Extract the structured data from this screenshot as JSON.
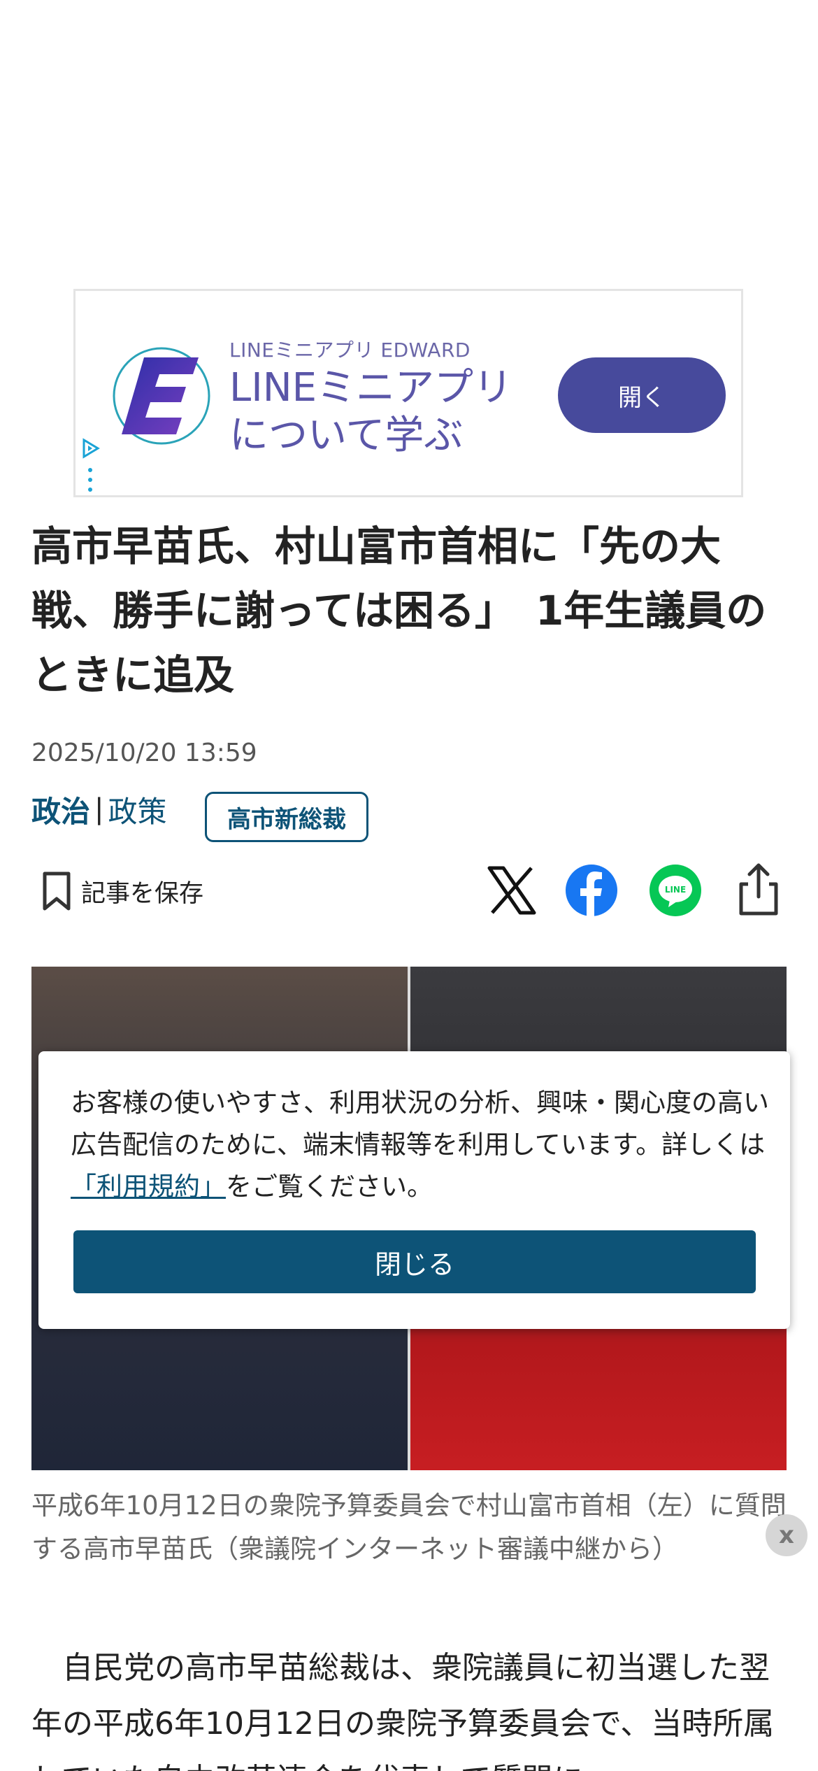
{
  "ad": {
    "eyebrow": "LINEミニアプリ EDWARD",
    "headline": "LINEミニアプリについて学ぶ",
    "open_button": "開く",
    "logo_letter": "E",
    "colors": {
      "button": "#474a9c",
      "headline": "#5a56a8"
    }
  },
  "article": {
    "title": "高市早苗氏、村山富市首相に「先の大戦、勝手に謝っては困る」　1年生議員のときに追及",
    "date": "2025/10/20 13:59",
    "category_main": "政治",
    "category_separator": "|",
    "category_sub": "政策",
    "tag": "高市新総裁",
    "save_label": "記事を保存",
    "caption": "平成6年10月12日の衆院予算委員会で村山富市首相（左）に質問する高市早苗氏（衆議院インターネット審議中継から）",
    "body": "　自民党の高市早苗総裁は、衆院議員に初当選した翌年の平成6年10月12日の衆院予算委員会で、当時所属していた自由改革連合を代表して質問に"
  },
  "share": {
    "icons": [
      "x-icon",
      "facebook-icon",
      "line-icon",
      "share-icon"
    ],
    "line_label": "LINE"
  },
  "consent": {
    "text_before": "お客様の使いやすさ、利用状況の分析、興味・関心度の高い広告配信のために、端末情報等を利用しています。詳しくは",
    "link": "「利用規約」",
    "text_after": "をご覧ください。",
    "close_button": "閉じる"
  },
  "floating_close": "x",
  "colors": {
    "accent": "#0d5377",
    "facebook": "#1877f2",
    "line": "#06c755"
  }
}
